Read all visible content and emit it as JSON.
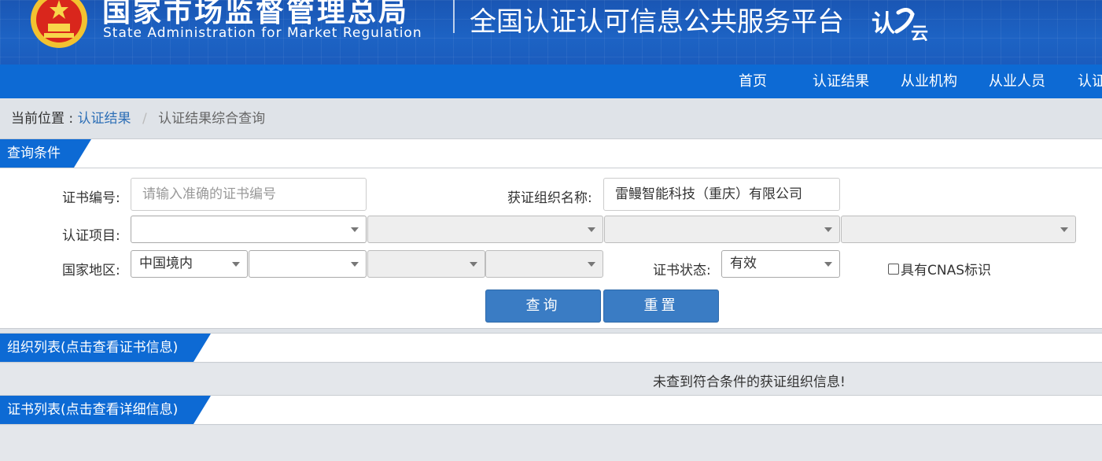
{
  "header": {
    "org_name_cn": "国家市场监督管理总局",
    "org_name_en": "State Administration  for  Market Regulation",
    "platform_title": "全国认证认可信息公共服务平台",
    "logo_text": "认e云",
    "colors": {
      "banner": "#1a56b4",
      "nav": "#0d6ad4"
    }
  },
  "nav": {
    "items": [
      "首页",
      "认证结果",
      "从业机构",
      "从业人员",
      "认证"
    ]
  },
  "breadcrumb": {
    "prefix": "当前位置 :",
    "link": "认证结果",
    "separator": "/",
    "current": "认证结果综合查询"
  },
  "query": {
    "section_title": "查询条件",
    "cert_no_label": "证书编号:",
    "cert_no_placeholder": "请输入准确的证书编号",
    "org_name_label": "获证组织名称:",
    "org_name_value": "雷鳗智能科技（重庆）有限公司",
    "project_label": "认证项目:",
    "region_label": "国家地区:",
    "region_value": "中国境内",
    "status_label": "证书状态:",
    "status_value": "有效",
    "cnas_label": "具有CNAS标识",
    "search_button": "查询",
    "reset_button": "重置"
  },
  "org_list": {
    "section_title": "组织列表(点击查看证书信息)",
    "empty_message": "未查到符合条件的获证组织信息!"
  },
  "cert_list": {
    "section_title": "证书列表(点击查看详细信息)"
  }
}
